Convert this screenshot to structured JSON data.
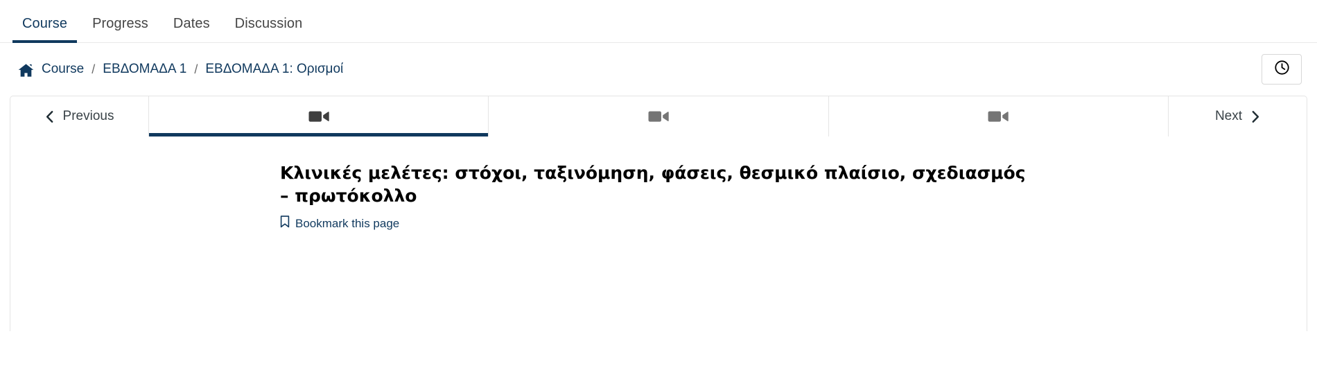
{
  "course_tabs": [
    {
      "label": "Course",
      "active": true
    },
    {
      "label": "Progress",
      "active": false
    },
    {
      "label": "Dates",
      "active": false
    },
    {
      "label": "Discussion",
      "active": false
    }
  ],
  "breadcrumb": {
    "home_icon": "home-icon",
    "items": [
      {
        "label": "Course",
        "current": false
      },
      {
        "label": "ΕΒΔΟΜΑΔΑ 1",
        "current": false
      },
      {
        "label": "ΕΒΔΟΜΑΔΑ 1: Ορισμοί",
        "current": true
      }
    ],
    "separator": "/",
    "history_button": {
      "icon": "clock-icon",
      "label": ""
    }
  },
  "unit_nav": {
    "previous": {
      "label": "Previous",
      "icon": "chevron-left-icon"
    },
    "next": {
      "label": "Next",
      "icon": "chevron-right-icon"
    },
    "units": [
      {
        "icon": "video-camera-icon",
        "active": true
      },
      {
        "icon": "video-camera-icon",
        "active": false
      },
      {
        "icon": "video-camera-icon",
        "active": false
      }
    ]
  },
  "content": {
    "title": "Κλινικές μελέτες: στόχοι, ταξινόμηση, φάσεις, θεσμικό πλαίσιο, σχεδιασμός – πρωτόκολλο",
    "bookmark": {
      "label": "Bookmark this page",
      "icon": "bookmark-icon"
    }
  },
  "colors": {
    "accent_navy": "#10395e",
    "tab_inactive_text": "#454545",
    "border": "#e4e4e4",
    "icon_active": "#3f3f3f",
    "icon_inactive": "#757575"
  }
}
